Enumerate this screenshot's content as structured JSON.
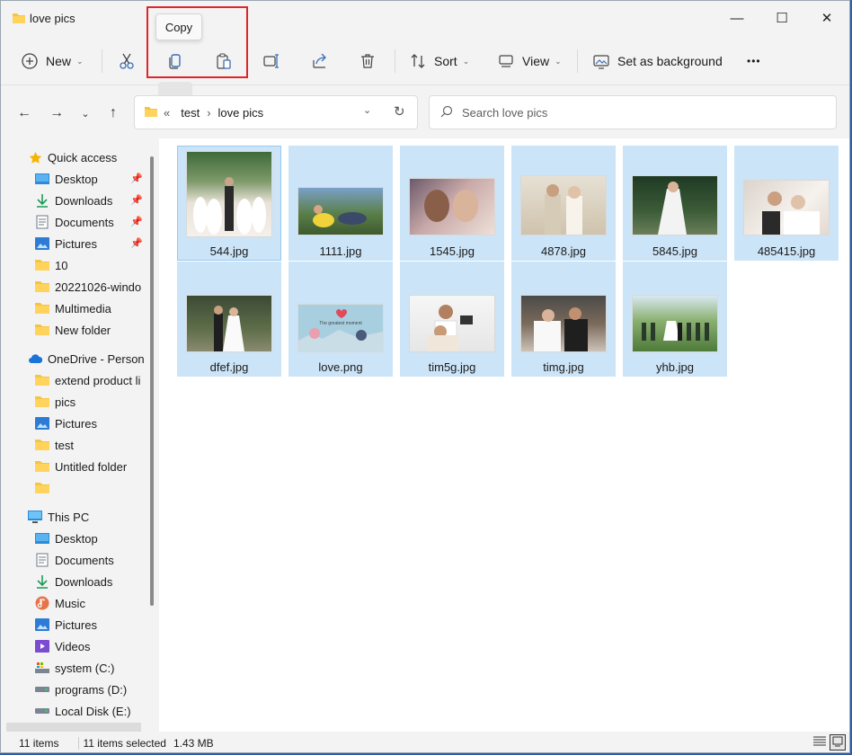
{
  "window": {
    "title": "love pics",
    "controls": {
      "minimize": "—",
      "maximize": "☐",
      "close": "✕"
    }
  },
  "toolbar": {
    "new_label": "New",
    "sort_label": "Sort",
    "view_label": "View",
    "set_background_label": "Set as background",
    "more_label": "•••",
    "tooltip": "Copy",
    "icons": [
      "new-icon",
      "cut-icon",
      "copy-icon",
      "paste-icon",
      "rename-icon",
      "share-icon",
      "delete-icon",
      "sort-icon",
      "view-icon",
      "set-background-icon",
      "more-icon"
    ]
  },
  "nav": {
    "breadcrumb_prefix": "«",
    "crumbs": [
      "test",
      "love pics"
    ],
    "separator": "›",
    "search_placeholder": "Search love pics"
  },
  "sidebar": {
    "quick_access": {
      "label": "Quick access",
      "items": [
        {
          "label": "Desktop",
          "icon": "desktop-icon",
          "pinned": true
        },
        {
          "label": "Downloads",
          "icon": "downloads-icon",
          "pinned": true
        },
        {
          "label": "Documents",
          "icon": "documents-icon",
          "pinned": true
        },
        {
          "label": "Pictures",
          "icon": "pictures-icon",
          "pinned": true
        },
        {
          "label": "10",
          "icon": "folder-icon",
          "pinned": false
        },
        {
          "label": "20221026-windo",
          "icon": "folder-icon",
          "pinned": false
        },
        {
          "label": "Multimedia",
          "icon": "folder-icon",
          "pinned": false
        },
        {
          "label": "New folder",
          "icon": "folder-icon",
          "pinned": false
        }
      ]
    },
    "onedrive": {
      "label": "OneDrive - Person",
      "items": [
        {
          "label": "extend product li",
          "icon": "folder-icon"
        },
        {
          "label": "pics",
          "icon": "folder-icon"
        },
        {
          "label": "Pictures",
          "icon": "pictures-icon"
        },
        {
          "label": "test",
          "icon": "folder-icon"
        },
        {
          "label": "Untitled folder",
          "icon": "folder-icon"
        },
        {
          "label": "",
          "icon": "folder-icon"
        }
      ]
    },
    "this_pc": {
      "label": "This PC",
      "items": [
        {
          "label": "Desktop",
          "icon": "desktop-icon"
        },
        {
          "label": "Documents",
          "icon": "documents-icon"
        },
        {
          "label": "Downloads",
          "icon": "downloads-icon"
        },
        {
          "label": "Music",
          "icon": "music-icon"
        },
        {
          "label": "Pictures",
          "icon": "pictures-icon"
        },
        {
          "label": "Videos",
          "icon": "videos-icon"
        },
        {
          "label": "system (C:)",
          "icon": "system-drive-icon"
        },
        {
          "label": "programs (D:)",
          "icon": "drive-icon"
        },
        {
          "label": "Local Disk (E:)",
          "icon": "drive-icon"
        }
      ]
    }
  },
  "files": [
    {
      "name": "544.jpg"
    },
    {
      "name": "1111.jpg"
    },
    {
      "name": "1545.jpg"
    },
    {
      "name": "4878.jpg"
    },
    {
      "name": "5845.jpg"
    },
    {
      "name": "485415.jpg"
    },
    {
      "name": "dfef.jpg"
    },
    {
      "name": "love.png",
      "caption": "The greatest moment"
    },
    {
      "name": "tim5g.jpg"
    },
    {
      "name": "timg.jpg"
    },
    {
      "name": "yhb.jpg"
    }
  ],
  "status": {
    "items_count": "11 items",
    "selected": "11 items selected",
    "size": "1.43 MB"
  },
  "colors": {
    "selection": "#cce4f7",
    "highlight_border": "#e0252a",
    "folder": "#f4c542",
    "window_bg": "#f3f3f3"
  }
}
